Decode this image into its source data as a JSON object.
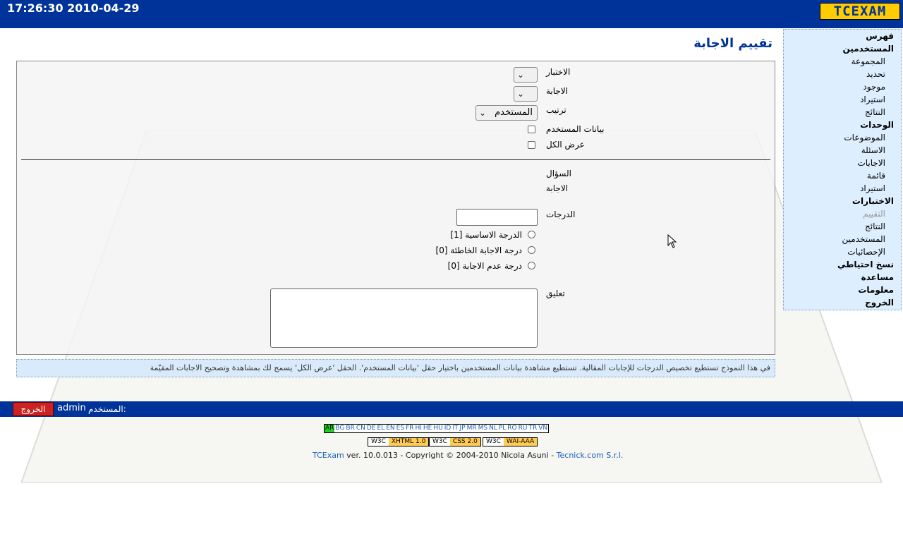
{
  "header": {
    "clock": "17:26:30 2010-04-29",
    "logo": "TCEXAM"
  },
  "page_title": "تقييم الاجابة",
  "menu": [
    {
      "label": "فهرس",
      "type": "h"
    },
    {
      "label": "المستخدمين",
      "type": "h"
    },
    {
      "label": "المجموعة",
      "type": "s"
    },
    {
      "label": "تحديد",
      "type": "s"
    },
    {
      "label": "موجود",
      "type": "s"
    },
    {
      "label": "استيراد",
      "type": "s"
    },
    {
      "label": "النتائج",
      "type": "s"
    },
    {
      "label": "الوحدات",
      "type": "h"
    },
    {
      "label": "الموضوعات",
      "type": "s"
    },
    {
      "label": "الاسئلة",
      "type": "s"
    },
    {
      "label": "الاجابات",
      "type": "s"
    },
    {
      "label": "قائمة",
      "type": "s"
    },
    {
      "label": "استيراد",
      "type": "s"
    },
    {
      "label": "الاختبارات",
      "type": "h"
    },
    {
      "label": "التقييم",
      "type": "s",
      "disabled": true
    },
    {
      "label": "النتائج",
      "type": "s"
    },
    {
      "label": "المستخدمين",
      "type": "s"
    },
    {
      "label": "الإحصائيات",
      "type": "s"
    },
    {
      "label": "نسخ احتياطي",
      "type": "h"
    },
    {
      "label": "مساعدة",
      "type": "h"
    },
    {
      "label": "معلومات",
      "type": "h"
    },
    {
      "label": "الخروج",
      "type": "h"
    }
  ],
  "form": {
    "test_label": "الاختبار",
    "answer_label": "الاجابة",
    "order_label": "ترتيب",
    "order_value": "المستخدم",
    "userdata_label": "بيانات المستخدم",
    "showall_label": "عرض الكل",
    "question_label": "السؤال",
    "answer2_label": "الاجابة",
    "grades_label": "الدرجات",
    "grade_options": [
      "الدرجة الاساسية [1]",
      "درجة الاجابة الخاطئة [0]",
      "درجة عدم الاجابة [0]"
    ],
    "comment_label": "تعليق"
  },
  "help_text": "في هذا النموذج تستطيع تخصيص الدرجات للإجابات المقالية. تستطيع مشاهدة بيانات المستخدمين باختيار حقل 'بيانات المستخدم'. الحقل 'عرض الكل' يسمح لك بمشاهدة وتصحيح الاجابات المقيّمة",
  "userbar": {
    "logout": "الخروج",
    "username": "admin",
    "user_label": "المستخدم:"
  },
  "languages": {
    "current": "AR",
    "others": [
      "BG",
      "BR",
      "CN",
      "DE",
      "EL",
      "EN",
      "ES",
      "FR",
      "HI",
      "HE",
      "HU",
      "ID",
      "IT",
      "JP",
      "MR",
      "MS",
      "NL",
      "PL",
      "RO",
      "RU",
      "TR",
      "VN"
    ]
  },
  "w3c": [
    {
      "a": "W3C",
      "b": "XHTML 1.0"
    },
    {
      "a": "W3C",
      "b": "CSS 2.0"
    },
    {
      "a": "W3C",
      "b": "WAI-AAA"
    }
  ],
  "credit": {
    "app": "TCExam",
    "text": " ver. 10.0.013 - Copyright © 2004-2010 Nicola Asuni - ",
    "company": "Tecnick.com S.r.l."
  },
  "colors": {
    "header": "#003399",
    "menu_bg": "#ddeeff",
    "logo": "#ffcc00",
    "logout": "#cc2222"
  }
}
